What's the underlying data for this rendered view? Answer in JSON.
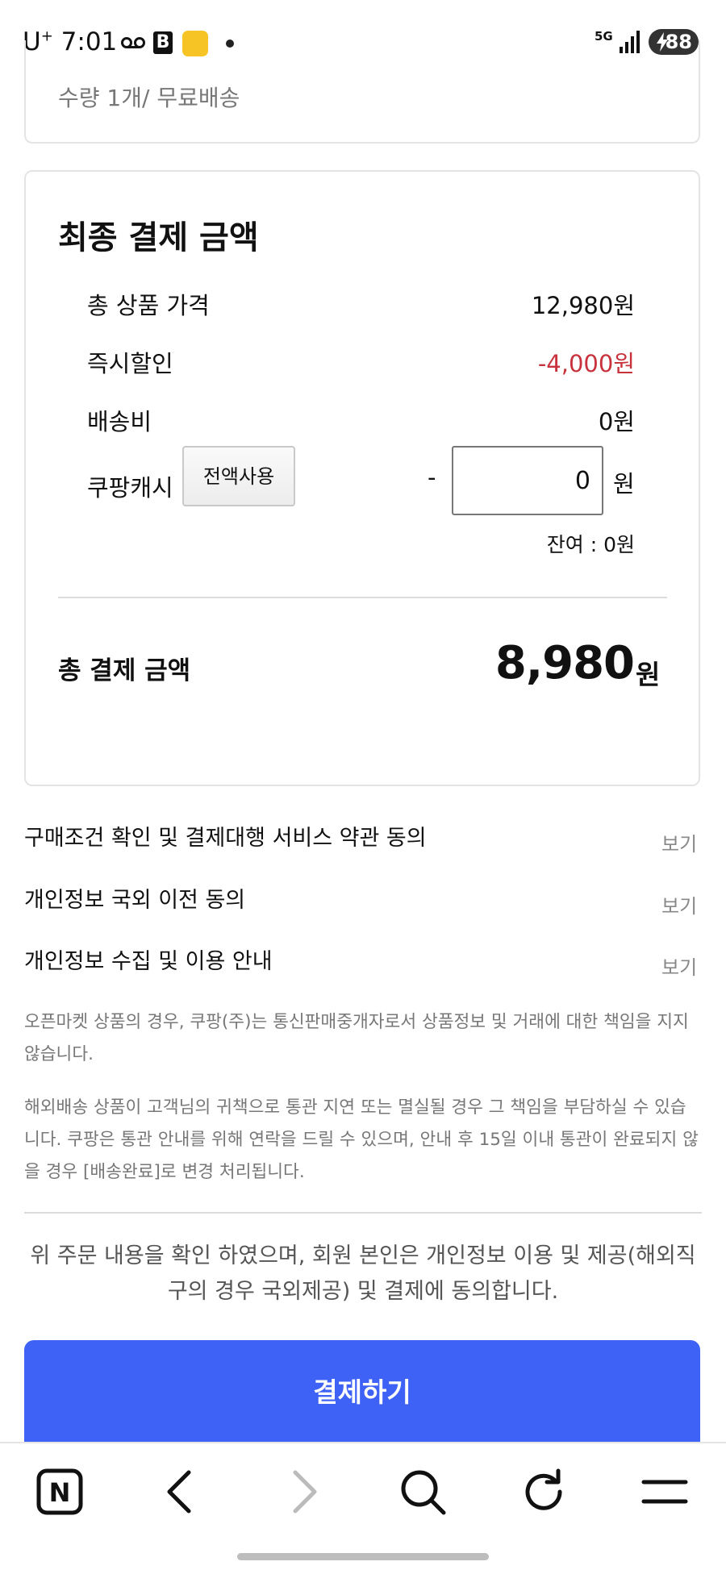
{
  "status_bar": {
    "carrier": "U",
    "carrier_sup": "+",
    "time": "7:01",
    "b_icon": "B",
    "network": "5G",
    "battery": "88"
  },
  "order": {
    "summary": "수량 1개/  무료배송"
  },
  "payment": {
    "title": "최종 결제 금액",
    "rows": [
      {
        "label": "총 상품 가격",
        "value": "12,980원"
      },
      {
        "label": "즉시할인",
        "value": "-4,000원"
      },
      {
        "label": "배송비",
        "value": "0원"
      }
    ],
    "cash": {
      "label": "쿠팡캐시",
      "use_all_label": "전액사용",
      "minus": "-",
      "input_value": "0",
      "unit": "원",
      "balance": "잔여 : 0원"
    },
    "total_label": "총 결제 금액",
    "total_amount": "8,980",
    "total_unit": "원"
  },
  "agreements": [
    {
      "label": "구매조건 확인 및 결제대행 서비스 약관 동의",
      "action": "보기"
    },
    {
      "label": "개인정보 국외 이전 동의",
      "action": "보기"
    },
    {
      "label": "개인정보 수집 및 이용 안내",
      "action": "보기"
    }
  ],
  "notices": [
    "오픈마켓 상품의 경우, 쿠팡(주)는 통신판매중개자로서 상품정보 및 거래에 대한 책임을 지지 않습니다.",
    "해외배송 상품이 고객님의 귀책으로 통관 지연 또는 멸실될 경우 그 책임을 부담하실 수 있습니다. 쿠팡은 통관 안내를 위해 연락을 드릴 수 있으며, 안내 후 15일 이내 통관이 완료되지 않을 경우 [배송완료]로 변경 처리됩니다."
  ],
  "consent": "위 주문 내용을 확인 하였으며, 회원 본인은 개인정보 이용 및 제공(해외직구의 경우 국외제공) 및 결제에 동의합니다.",
  "pay_button": "결제하기",
  "toolbar": {
    "home_letter": "N",
    "icons": [
      "naver-home-icon",
      "back-icon",
      "forward-icon",
      "search-icon",
      "refresh-icon",
      "menu-icon"
    ]
  },
  "colors": {
    "accent": "#3f62f6",
    "discount": "#c8323c",
    "border": "#e4e4e4"
  }
}
